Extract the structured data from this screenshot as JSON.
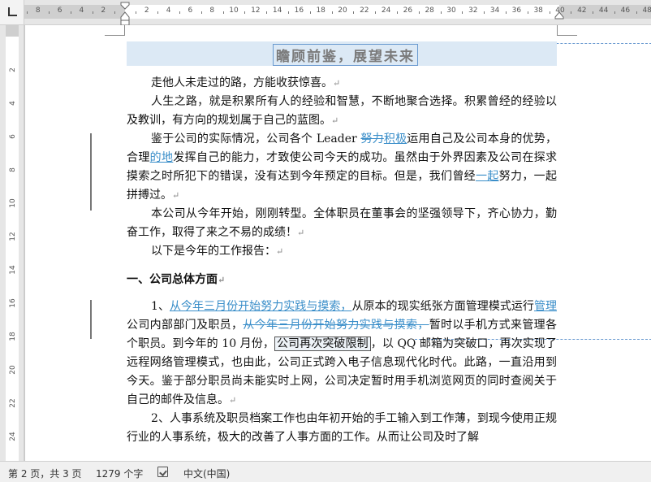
{
  "ruler": {
    "ticks": [
      "8",
      "6",
      "4",
      "2",
      "2",
      "4",
      "6",
      "8",
      "10",
      "12",
      "14",
      "16",
      "18",
      "20",
      "22",
      "24",
      "26",
      "28",
      "30",
      "32",
      "34",
      "36",
      "38",
      "40",
      "42",
      "44",
      "46",
      "48"
    ],
    "vticks": [
      "2",
      "4",
      "6",
      "8",
      "10",
      "12",
      "14",
      "16",
      "18",
      "20",
      "22",
      "24"
    ]
  },
  "document": {
    "title": "瞻顾前鉴，展望未来",
    "p1": "走他人未走过的路，方能收获惊喜。",
    "p2": "人生之路，就是积累所有人的经验和智慧，不断地聚合选择。积累曾经的经验以及教训，有方向的规划属于自己的蓝图。",
    "p3a": "鉴于公司的实际情况，公司各个 Leader ",
    "p3_del1": "努力",
    "p3_ins1": "积极",
    "p3b": "运用自己及公司本身的优势，合理",
    "p3_ins2": "的地",
    "p3c": "发挥自己的能力，才致使公司今天的成功。虽然由于外界因素及公司在探求摸索之时所犯下的错误，没有达到今年预定的目标。但是，我们曾经",
    "p3_ins3": "一起",
    "p3d": "努力，一起拼搏过。",
    "p4": "本公司从今年开始，刚刚转型。全体职员在董事会的坚强领导下，齐心协力，勤奋工作，取得了来之不易的成绩！",
    "p5": "以下是今年的工作报告：",
    "heading1": "一、公司总体方面",
    "p6a": "1、",
    "p6_ins1": "从今年三月份开始努力实践与摸索，",
    "p6b": "从原本的现实纸张方面管理模式运行",
    "p6_ins2": "管理",
    "p6c": "公司内部部门及职员，",
    "p6_del1": "从今年三月份开始努力实践与摸索，",
    "p6d": "暂时以手机方式来管理各个职员。到今年的 10 月份，",
    "p6_hl": "公司再次突破限制",
    "p6e": "，以 QQ 邮箱为突破口，再次实现了远程网络管理模式，也由此，公司正式跨入电子信息现代化时代。此路，一直沿用到今天。鉴于部分职员尚未能实时上网，公司决定暂时用手机浏览网页的同时查阅关于自己的邮件及信息。",
    "p7": "2、人事系统及职员档案工作也由年初开始的手工输入到工作薄，到现今使用正规行业的人事系统，极大的改善了人事方面的工作。从而让公司及时了解",
    "para_mark": "↵"
  },
  "status": {
    "page": "第 2 页，共 3 页",
    "words": "1279 个字",
    "language": "中文(中国)"
  }
}
